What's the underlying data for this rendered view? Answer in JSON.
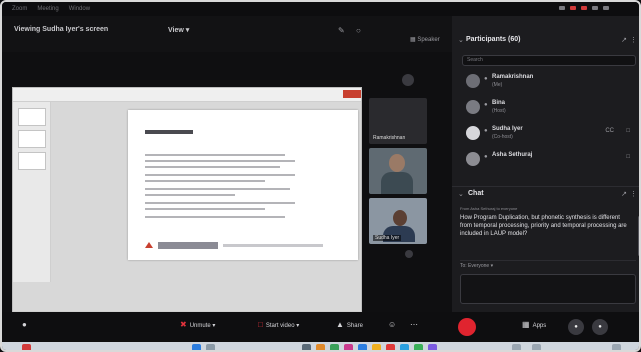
{
  "os_tabs": [
    "Zoom",
    "Meeting",
    "Window"
  ],
  "header": {
    "viewing_label": "Viewing Sudha Iyer's screen",
    "view_options": "View",
    "speaker_view": "Speaker"
  },
  "participants": {
    "title": "Participants (60)",
    "search_placeholder": "Search",
    "items": [
      {
        "name": "Ramakrishnan",
        "sub": "(Me)"
      },
      {
        "name": "Bina",
        "sub": "(Host)"
      },
      {
        "name": "Sudha Iyer",
        "sub": "(Co-host)",
        "right": "CC"
      },
      {
        "name": "Asha Sethuraj",
        "sub": ""
      }
    ]
  },
  "tiles": [
    {
      "name": "Ramakrishnan",
      "sub": ""
    },
    {
      "name": "",
      "sub": ""
    },
    {
      "name": "Sudha Iyer",
      "sub": ""
    }
  ],
  "chat": {
    "title": "Chat",
    "meta": "From Asha Sethuraj to everyone",
    "message": "How Program Duplication, but phonetic synthesis is different from temporal processing, priority and temporal processing are included in LAUP model?",
    "to_label": "To: Everyone"
  },
  "toolbar": {
    "unmute": "Unmute",
    "start_video": "Start video",
    "share": "Share",
    "apps": "Apps"
  },
  "colors": {
    "leave": "#e0242f",
    "ppt_accent": "#c8402f",
    "panel_bg": "#1c1c1f"
  }
}
